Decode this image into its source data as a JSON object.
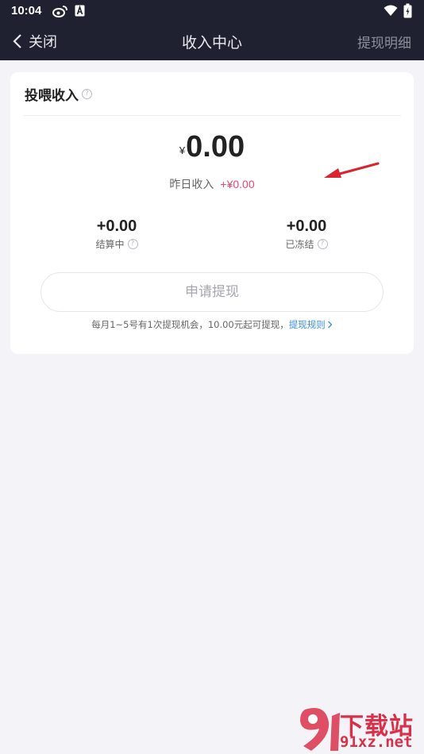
{
  "status_bar": {
    "time": "10:04",
    "icons": [
      "weibo-icon",
      "a-badge-icon",
      "wifi-icon",
      "battery-icon"
    ]
  },
  "nav": {
    "back_label": "关闭",
    "title": "收入中心",
    "right_label": "提现明细"
  },
  "card": {
    "title": "投喂收入",
    "currency": "¥",
    "amount": "0.00",
    "yesterday_label": "昨日收入",
    "yesterday_value": "+¥0.00",
    "stats": [
      {
        "value": "+0.00",
        "label": "结算中"
      },
      {
        "value": "+0.00",
        "label": "已冻结"
      }
    ],
    "withdraw_button": "申请提现",
    "note_text": "每月1~5号有1次提现机会，10.00元起可提现，",
    "note_link": "提现规则"
  },
  "watermark": {
    "text": "下载站",
    "url": "91xz.net"
  },
  "colors": {
    "nav_bg": "#1f2130",
    "page_bg": "#f4f4f8",
    "accent_pink": "#f0456c",
    "link_blue": "#3c8de0",
    "annotation_red": "#d9232e"
  }
}
